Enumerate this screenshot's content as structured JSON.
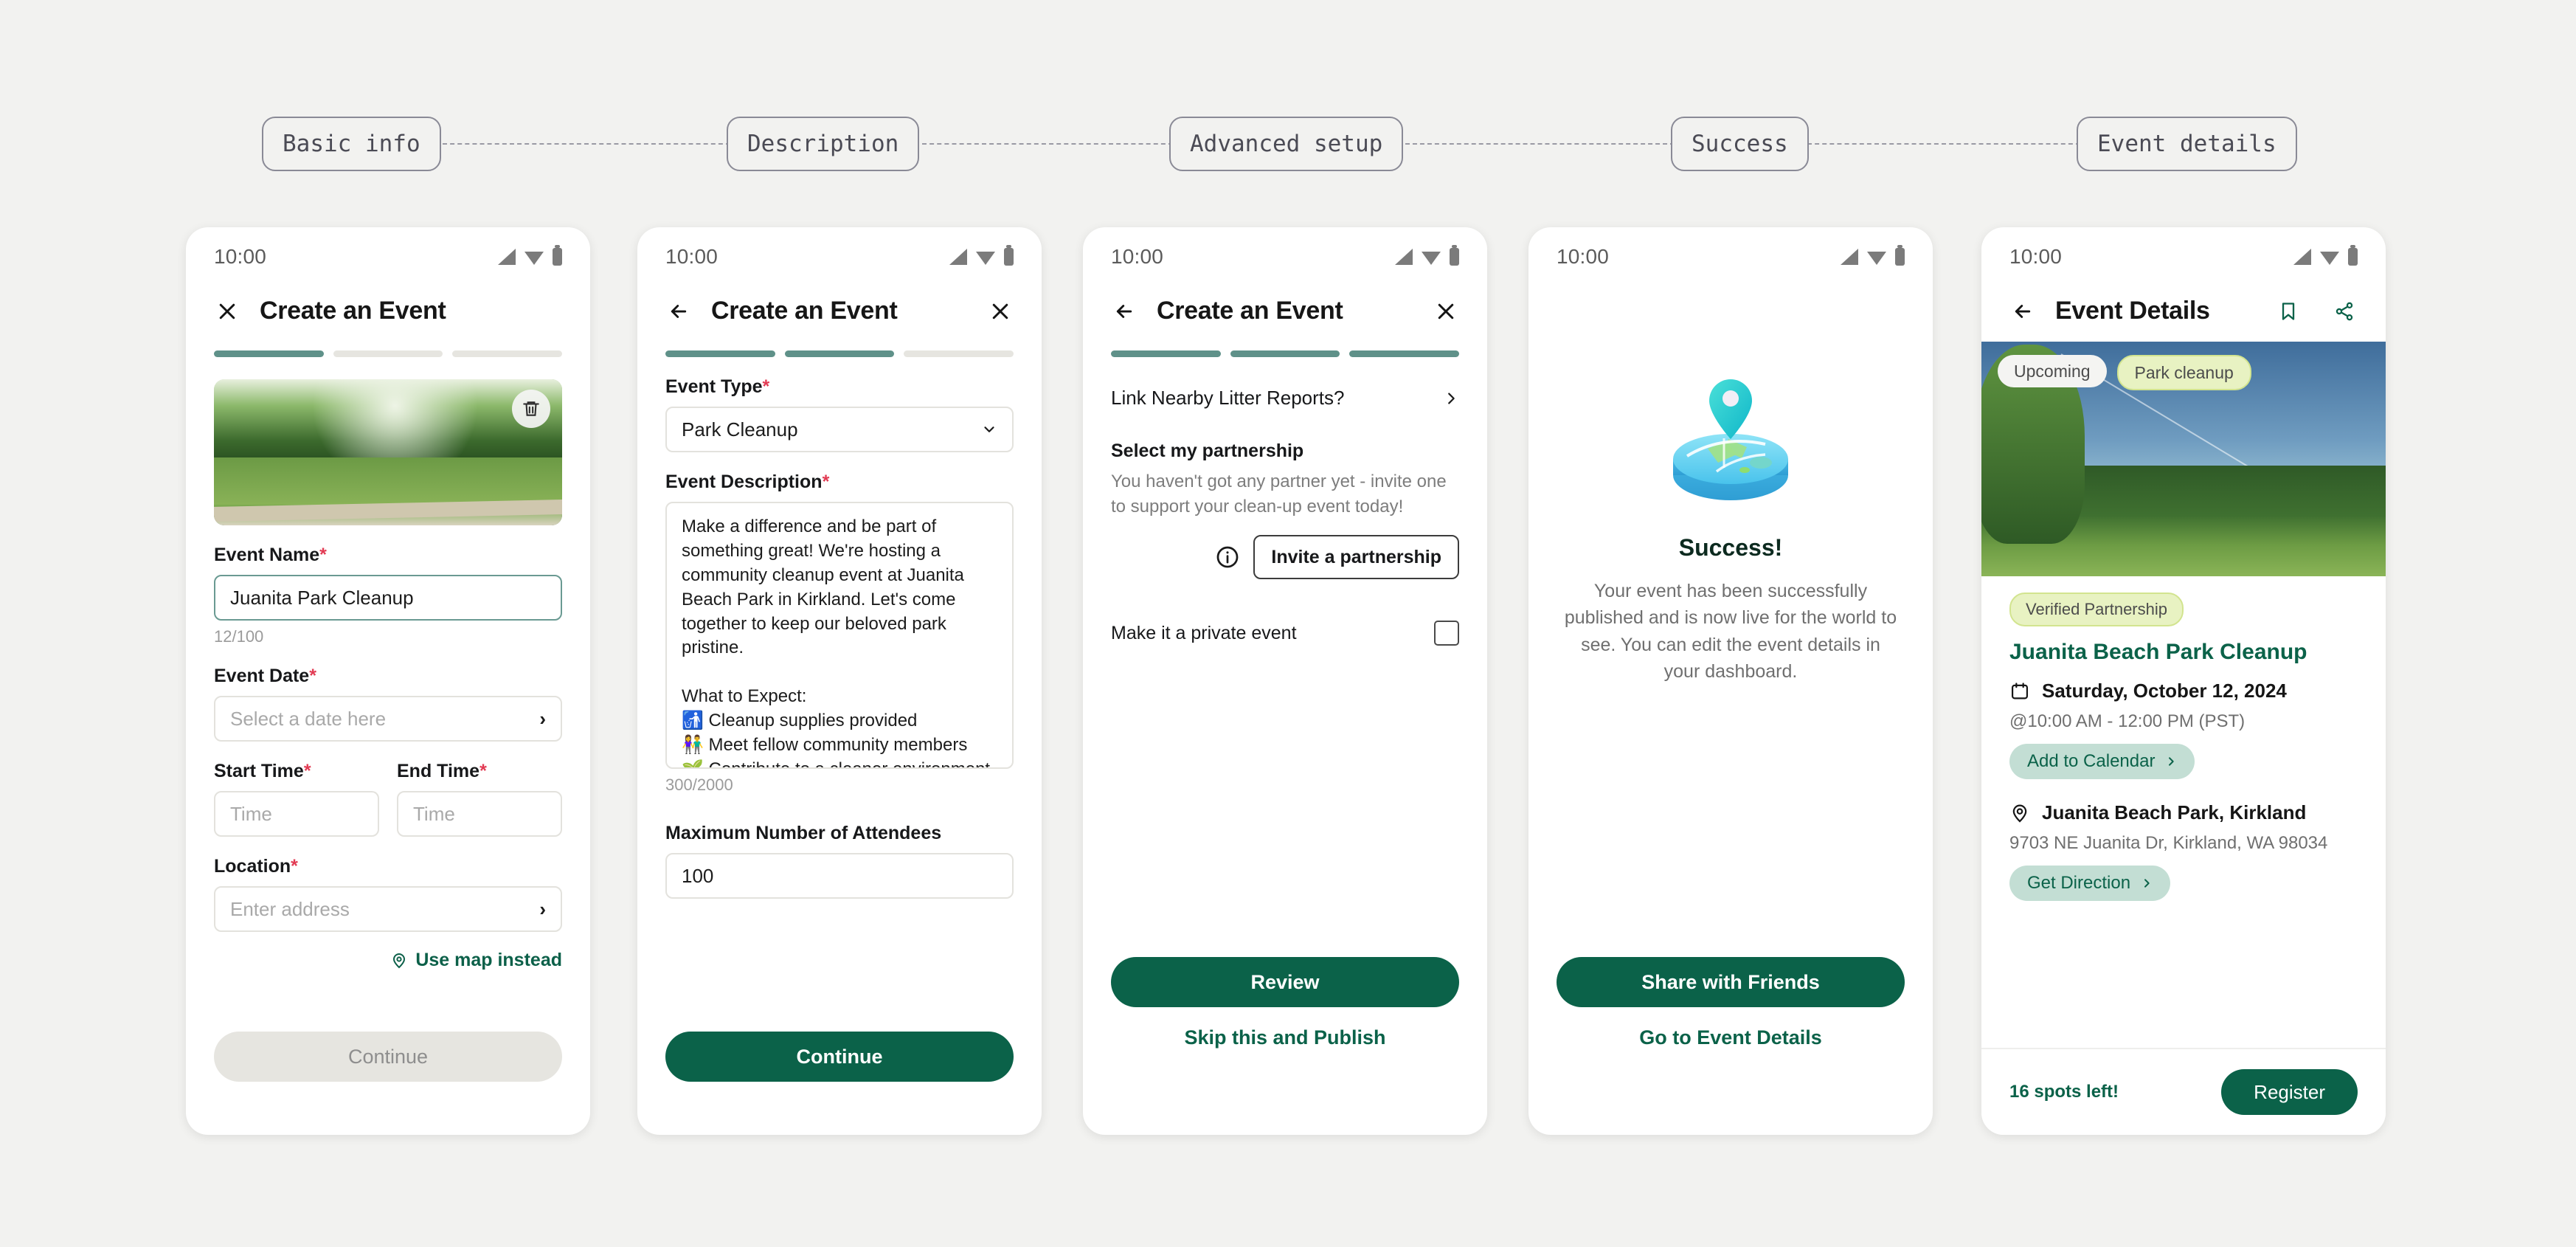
{
  "flow": {
    "steps": [
      {
        "label": "Basic info"
      },
      {
        "label": "Description"
      },
      {
        "label": "Advanced setup"
      },
      {
        "label": "Success"
      },
      {
        "label": "Event details"
      }
    ]
  },
  "colors": {
    "primary_green": "#0b6249",
    "progress_teal": "#5f9189",
    "lime_chip": "#e8f2c2",
    "mint_pill": "#c3ded4",
    "required_red": "#e23b53"
  },
  "status_bar": {
    "time": "10:00"
  },
  "screen1": {
    "title": "Create an Event",
    "close_icon": "close-icon",
    "progress": {
      "total": 3,
      "filled": 1
    },
    "image": {
      "delete_icon": "trash-icon"
    },
    "event_name": {
      "label": "Event Name",
      "required": "*",
      "value": "Juanita Park Cleanup",
      "counter": "12/100"
    },
    "event_date": {
      "label": "Event Date",
      "required": "*",
      "placeholder": "Select a date here"
    },
    "start_time": {
      "label": "Start Time",
      "required": "*",
      "placeholder": "Time"
    },
    "end_time": {
      "label": "End Time",
      "required": "*",
      "placeholder": "Time"
    },
    "location": {
      "label": "Location",
      "required": "*",
      "placeholder": "Enter address"
    },
    "map_link": "Use map instead",
    "continue_label": "Continue"
  },
  "screen2": {
    "title": "Create an Event",
    "back_icon": "arrow-left-icon",
    "close_icon": "close-icon",
    "progress": {
      "total": 3,
      "filled": 2
    },
    "event_type": {
      "label": "Event Type",
      "required": "*",
      "value": "Park Cleanup"
    },
    "event_description": {
      "label": "Event Description",
      "required": "*",
      "value": "Make a difference and be part of something great! We're hosting a community cleanup event at Juanita Beach Park in Kirkland. Let's come together to keep our beloved park pristine.\n\nWhat to Expect:\n🚮 Cleanup supplies provided\n👫 Meet fellow community members\n🌱 Contribute to a cleaner environment",
      "counter": "300/2000"
    },
    "max_attendees": {
      "label": "Maximum Number of Attendees",
      "value": "100"
    },
    "continue_label": "Continue"
  },
  "screen3": {
    "title": "Create an Event",
    "back_icon": "arrow-left-icon",
    "close_icon": "close-icon",
    "progress": {
      "total": 3,
      "filled": 3
    },
    "link_reports": {
      "label": "Link Nearby Litter Reports?",
      "chevron": "chevron-right-icon"
    },
    "partnership": {
      "title": "Select my partnership",
      "help": "You haven't got any partner yet - invite one to support your clean-up event today!",
      "info_icon": "info-icon",
      "invite_label": "Invite a partnership"
    },
    "private_event": {
      "label": "Make it a private event",
      "checked": false
    },
    "primary_label": "Review",
    "secondary_label": "Skip this and Publish"
  },
  "screen4": {
    "illustration": "map-pin-illustration",
    "title": "Success!",
    "message": "Your event has been successfully published and is now live for the world to see. You can edit the event details in your dashboard.",
    "primary_label": "Share with Friends",
    "secondary_label": "Go to Event Details"
  },
  "screen5": {
    "title": "Event Details",
    "back_icon": "arrow-left-icon",
    "bookmark_icon": "bookmark-icon",
    "share_icon": "share-icon",
    "chips": [
      {
        "label": "Upcoming",
        "style": "white"
      },
      {
        "label": "Park cleanup",
        "style": "lime"
      }
    ],
    "verified_badge": "Verified Partnership",
    "event_title": "Juanita Beach Park Cleanup",
    "date": {
      "icon": "calendar-icon",
      "text": "Saturday, October 12, 2024"
    },
    "time": "@10:00 AM - 12:00 PM (PST)",
    "add_to_calendar": "Add to Calendar",
    "location": {
      "icon": "location-pin-icon",
      "text": "Juanita Beach Park, Kirkland"
    },
    "address": "9703 NE Juanita Dr, Kirkland, WA 98034",
    "get_direction": "Get Direction",
    "spots_left": "16 spots left!",
    "register_label": "Register"
  }
}
